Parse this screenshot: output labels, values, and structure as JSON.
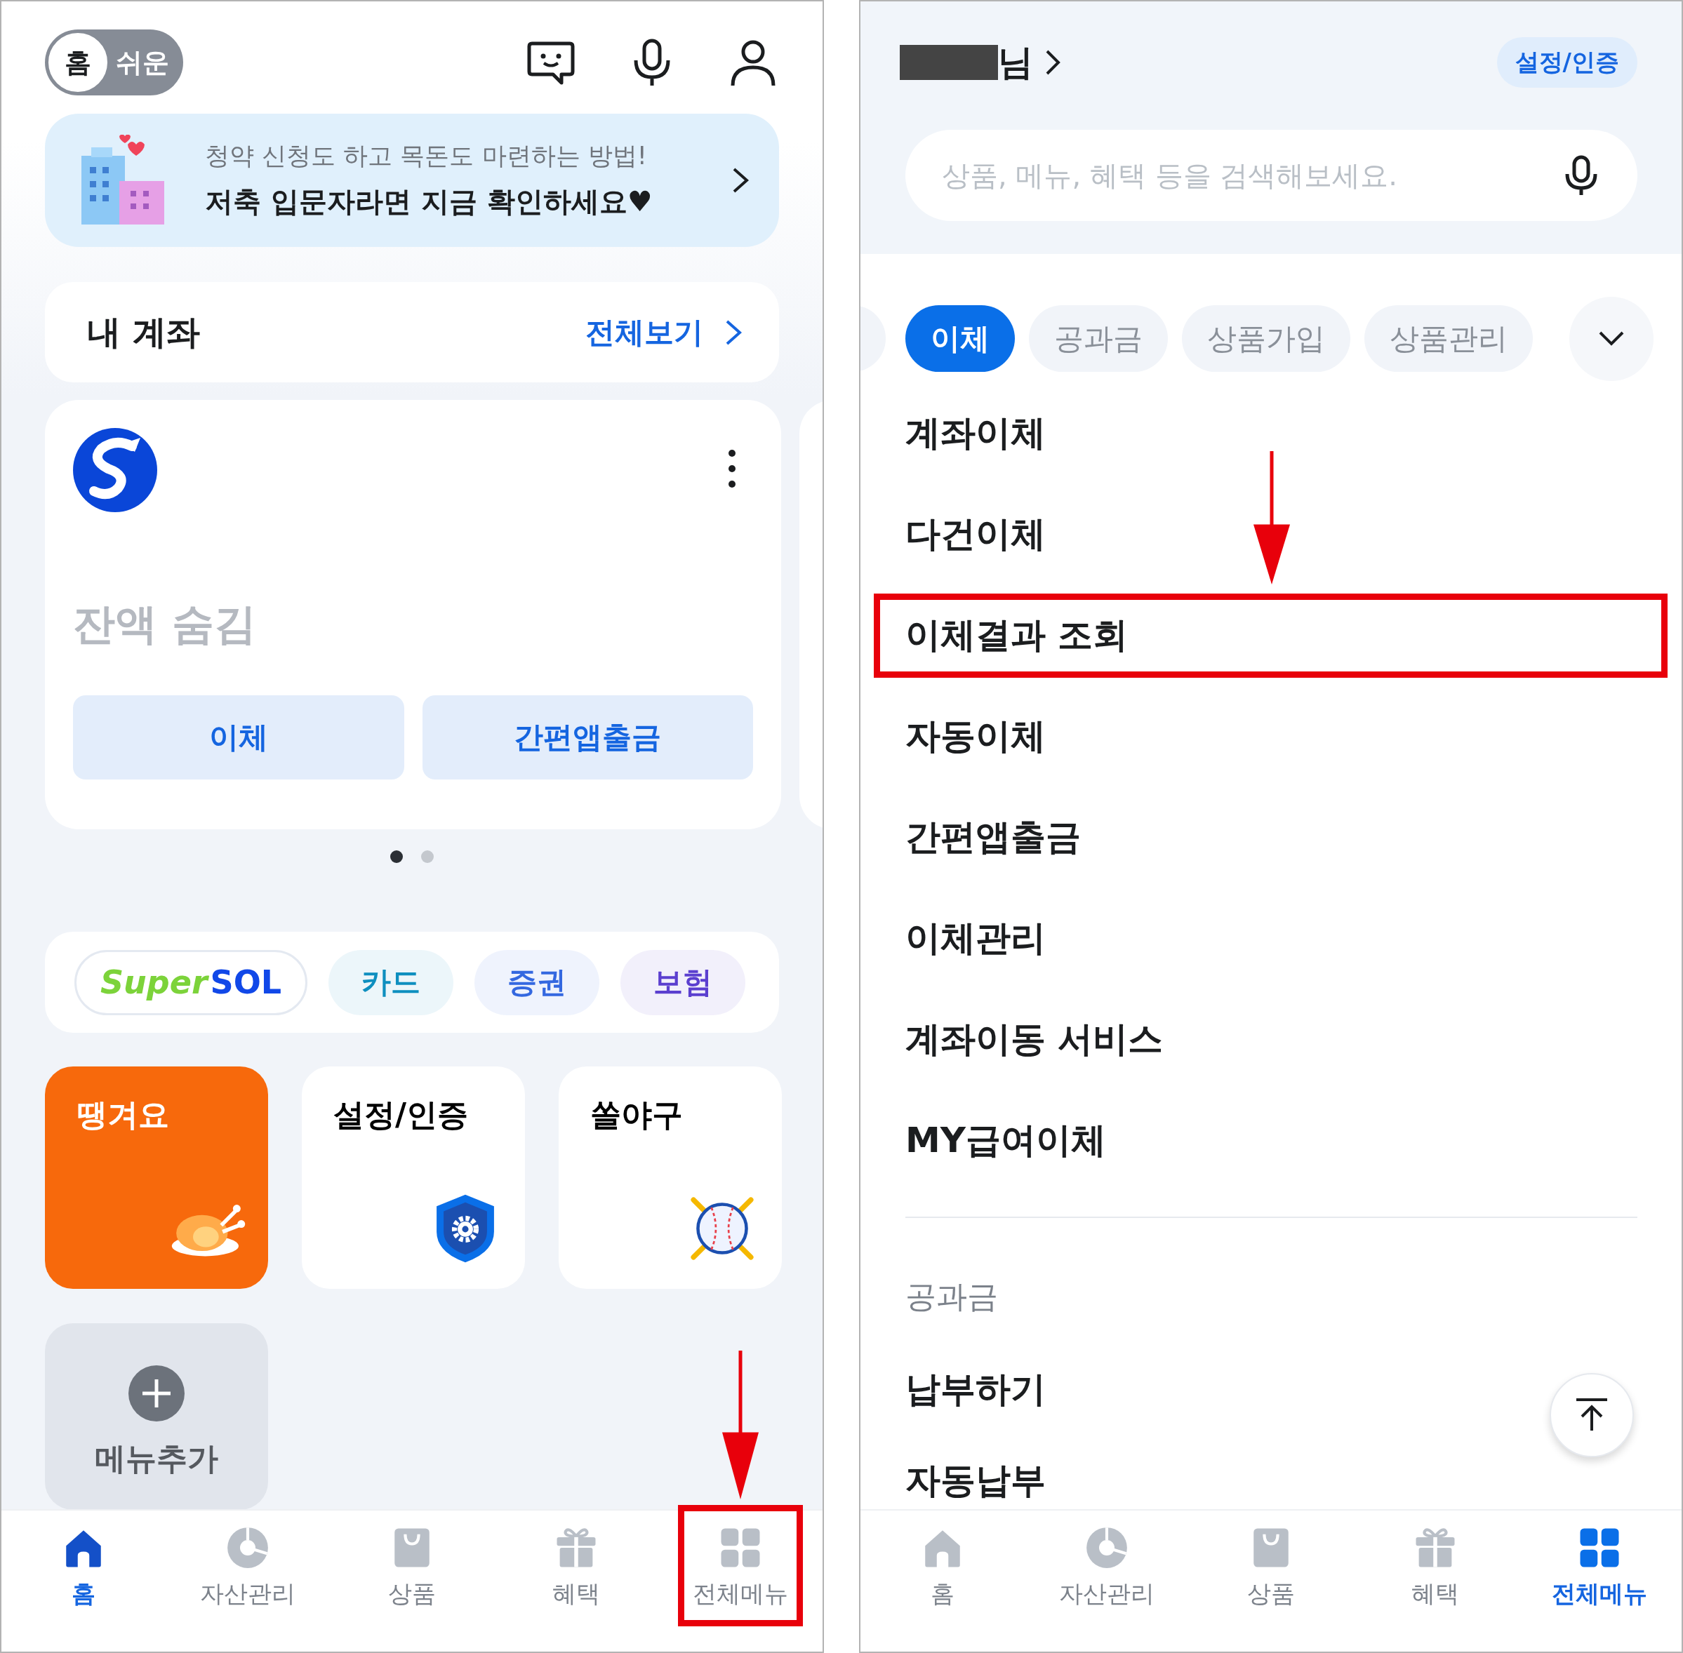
{
  "left_screen": {
    "mode_toggle": [
      {
        "label": "홈",
        "selected": true
      },
      {
        "label": "쉬운",
        "selected": false
      }
    ],
    "banner": {
      "subtitle": "청약 신청도 하고 목돈도 마련하는 방법!",
      "title": "저축 입문자라면 지금 확인하세요♥"
    },
    "my_accounts": {
      "title": "내 계좌",
      "link": "전체보기"
    },
    "account_card": {
      "balance": "잔액 숨김",
      "buttons": [
        "이체",
        "간편앱출금"
      ]
    },
    "pager": [
      {
        "selected": true
      },
      {
        "selected": false
      }
    ],
    "affiliates": [
      {
        "kind": "logo",
        "parts": [
          "Super",
          "SOL"
        ]
      },
      {
        "kind": "chip",
        "label": "카드",
        "color": "#0e8fbf"
      },
      {
        "kind": "chip",
        "label": "증권",
        "color": "#3468e0"
      },
      {
        "kind": "chip",
        "label": "보험",
        "color": "#5b3fcf"
      }
    ],
    "tiles": [
      {
        "kind": "food",
        "label": "땡겨요"
      },
      {
        "kind": "security",
        "label": "설정/인증"
      },
      {
        "kind": "baseball",
        "label": "쏠야구"
      },
      {
        "kind": "add",
        "label": "메뉴추가"
      }
    ],
    "bottom_nav": [
      {
        "kind": "home",
        "label": "홈",
        "selected": true,
        "highlighted": false
      },
      {
        "kind": "assets",
        "label": "자산관리",
        "selected": false,
        "highlighted": false
      },
      {
        "kind": "products",
        "label": "상품",
        "selected": false,
        "highlighted": false
      },
      {
        "kind": "benefits",
        "label": "혜택",
        "selected": false,
        "highlighted": false
      },
      {
        "kind": "menu",
        "label": "전체메뉴",
        "selected": false,
        "highlighted": true
      }
    ]
  },
  "right_screen": {
    "greeting_suffix": "님",
    "settings_button": "설정/인증",
    "search": {
      "placeholder": "상품, 메뉴, 혜택 등을 검색해보세요."
    },
    "category_chips": [
      {
        "label": "이체",
        "selected": true
      },
      {
        "label": "공과금",
        "selected": false
      },
      {
        "label": "상품가입",
        "selected": false
      },
      {
        "label": "상품관리",
        "selected": false
      }
    ],
    "sections": [
      {
        "items": [
          {
            "label": "계좌이체",
            "highlighted": false
          },
          {
            "label": "다건이체",
            "highlighted": false
          },
          {
            "label": "이체결과 조회",
            "highlighted": true
          },
          {
            "label": "자동이체",
            "highlighted": false
          },
          {
            "label": "간편앱출금",
            "highlighted": false
          },
          {
            "label": "이체관리",
            "highlighted": false
          },
          {
            "label": "계좌이동 서비스",
            "highlighted": false
          },
          {
            "label": "MY급여이체",
            "highlighted": false
          }
        ]
      },
      {
        "title": "공과금",
        "items": [
          {
            "label": "납부하기",
            "highlighted": false
          },
          {
            "label": "자동납부",
            "highlighted": false
          }
        ]
      }
    ],
    "bottom_nav": [
      {
        "kind": "home",
        "label": "홈",
        "selected": false,
        "highlighted": false
      },
      {
        "kind": "assets",
        "label": "자산관리",
        "selected": false,
        "highlighted": false
      },
      {
        "kind": "products",
        "label": "상품",
        "selected": false,
        "highlighted": false
      },
      {
        "kind": "benefits",
        "label": "혜택",
        "selected": false,
        "highlighted": false
      },
      {
        "kind": "menu",
        "label": "전체메뉴",
        "selected": true,
        "highlighted": false
      }
    ]
  }
}
